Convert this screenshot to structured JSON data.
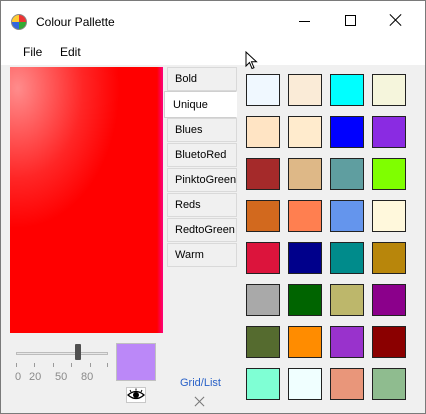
{
  "window": {
    "title": "Colour Pallette"
  },
  "menu": {
    "items": [
      "File",
      "Edit"
    ]
  },
  "tabs": {
    "items": [
      "Bold",
      "Unique",
      "Blues",
      "BluetoRed",
      "PinktoGreen",
      "Reds",
      "RedtoGreen",
      "Warm"
    ],
    "active": "Unique"
  },
  "slider": {
    "value": 70,
    "tick_labels": [
      "0",
      "20",
      "50",
      "80"
    ]
  },
  "preview": {
    "color": "#bb88f8"
  },
  "grid_list_label": "Grid/List",
  "swatches": [
    "#f0f8ff",
    "#faebd7",
    "#00ffff",
    "#f5f5dc",
    "#ffe4c4",
    "#ffebcd",
    "#0000ff",
    "#8a2be2",
    "#a52a2a",
    "#deb887",
    "#5f9ea0",
    "#7fff00",
    "#d2691e",
    "#ff7f50",
    "#6495ed",
    "#fff8dc",
    "#dc143c",
    "#00008b",
    "#008b8b",
    "#b8860b",
    "#a9a9a9",
    "#006400",
    "#bdb76b",
    "#8b008b",
    "#556b2f",
    "#ff8c00",
    "#9932cc",
    "#8b0000",
    "#7fffd4",
    "#f0ffff",
    "#e9967a",
    "#8fbc8f"
  ]
}
